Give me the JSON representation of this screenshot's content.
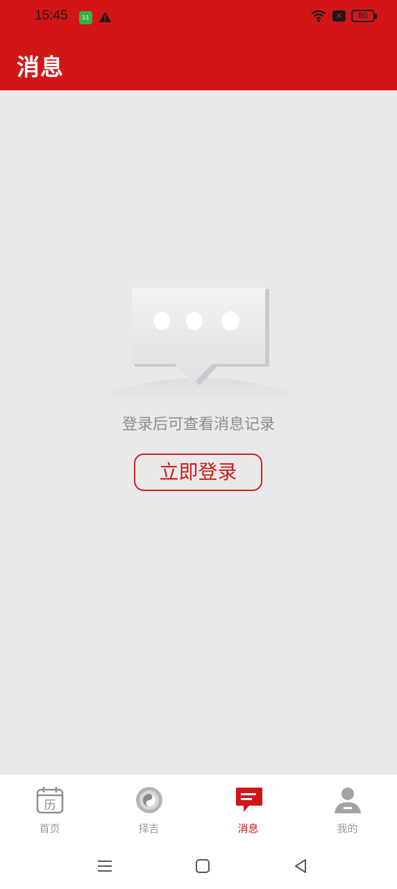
{
  "status_bar": {
    "time": "15:45",
    "battery": "80"
  },
  "header": {
    "title": "消息"
  },
  "empty_state": {
    "message": "登录后可查看消息记录",
    "login_button": "立即登录"
  },
  "tabs": [
    {
      "label": "首页",
      "icon": "calendar-icon",
      "icon_char": "历",
      "active": false
    },
    {
      "label": "择吉",
      "icon": "compass-icon",
      "active": false
    },
    {
      "label": "消息",
      "icon": "message-icon",
      "active": true
    },
    {
      "label": "我的",
      "icon": "user-icon",
      "active": false
    }
  ],
  "colors": {
    "brand": "#d21618",
    "background": "#e9e9e9",
    "muted": "#9a9a9a"
  }
}
